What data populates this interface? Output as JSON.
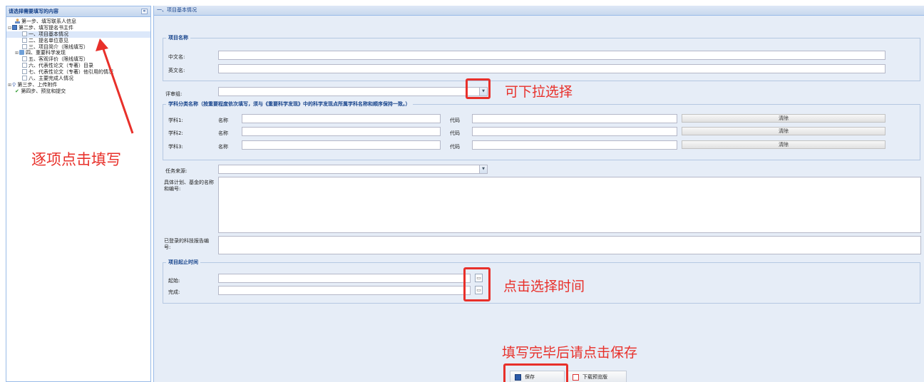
{
  "left_panel": {
    "title": "请选择需要填写的内容",
    "collapse_glyph": "«",
    "tree": [
      {
        "label": "第一步、填写联系人信息",
        "level": 1,
        "icon": "user-icon"
      },
      {
        "label": "第二步、填写提名书主件",
        "level": 0,
        "icon": "book-icon",
        "expander": "⊟"
      },
      {
        "label": "一、项目基本情况",
        "level": 2,
        "icon": "doc-icon",
        "selected": true
      },
      {
        "label": "二、提名单位意见",
        "level": 2,
        "icon": "doc-icon"
      },
      {
        "label": "三、项目简介（限线填写）",
        "level": 2,
        "icon": "doc-icon"
      },
      {
        "label": "四、重要科学发现",
        "level": 1,
        "icon": "folder-icon",
        "expander": "⊞"
      },
      {
        "label": "五、客观评价（限线填写）",
        "level": 2,
        "icon": "doc-icon"
      },
      {
        "label": "六、代表性论文（专著）目录",
        "level": 2,
        "icon": "doc-icon"
      },
      {
        "label": "七、代表性论文（专著）他引用的情况",
        "level": 2,
        "icon": "doc-icon"
      },
      {
        "label": "八、主要完成人情况",
        "level": 2,
        "icon": "doc-icon"
      },
      {
        "label": "第三步、上传附件",
        "level": 0,
        "icon": "paperclip-icon",
        "expander": "⊞"
      },
      {
        "label": "第四步、预览和提交",
        "level": 1,
        "icon": "checkmark-icon"
      }
    ]
  },
  "annotations": {
    "fill_each": "逐项点击填写",
    "dropdown_select": "可下拉选择",
    "click_select_time": "点击选择时间",
    "click_save_after": "填写完毕后请点击保存",
    "color": "#e8302a"
  },
  "right_panel": {
    "title": "一、项目基本情况",
    "project_name": {
      "legend": "项目名称",
      "chinese_label": "中文名:",
      "english_label": "英文名:",
      "chinese_value": "",
      "english_value": ""
    },
    "review_group": {
      "label": "评审组:",
      "value": ""
    },
    "discipline": {
      "legend": "学科分类名称（按重要程度依次填写，须与《重要科学发现》中的科学发现点所属学科名称和顺序保持一致。）",
      "rows": [
        {
          "label": "学科1:",
          "name_label": "名称",
          "code_label": "代码",
          "clear": "清除"
        },
        {
          "label": "学科2:",
          "name_label": "名称",
          "code_label": "代码",
          "clear": "清除"
        },
        {
          "label": "学科3:",
          "name_label": "名称",
          "code_label": "代码",
          "clear": "清除"
        }
      ]
    },
    "task_source": {
      "label": "任务来源:",
      "value": ""
    },
    "plan_fund": {
      "label": "具体计划、基金的名称和编号:",
      "value": ""
    },
    "tech_report": {
      "label": "已登录的科技报告编号:",
      "value": ""
    },
    "period": {
      "legend": "项目起止时间",
      "start_label": "起始:",
      "end_label": "完成:",
      "start_value": "",
      "end_value": ""
    },
    "save_button": "保存",
    "download_button": "下载预览版"
  }
}
